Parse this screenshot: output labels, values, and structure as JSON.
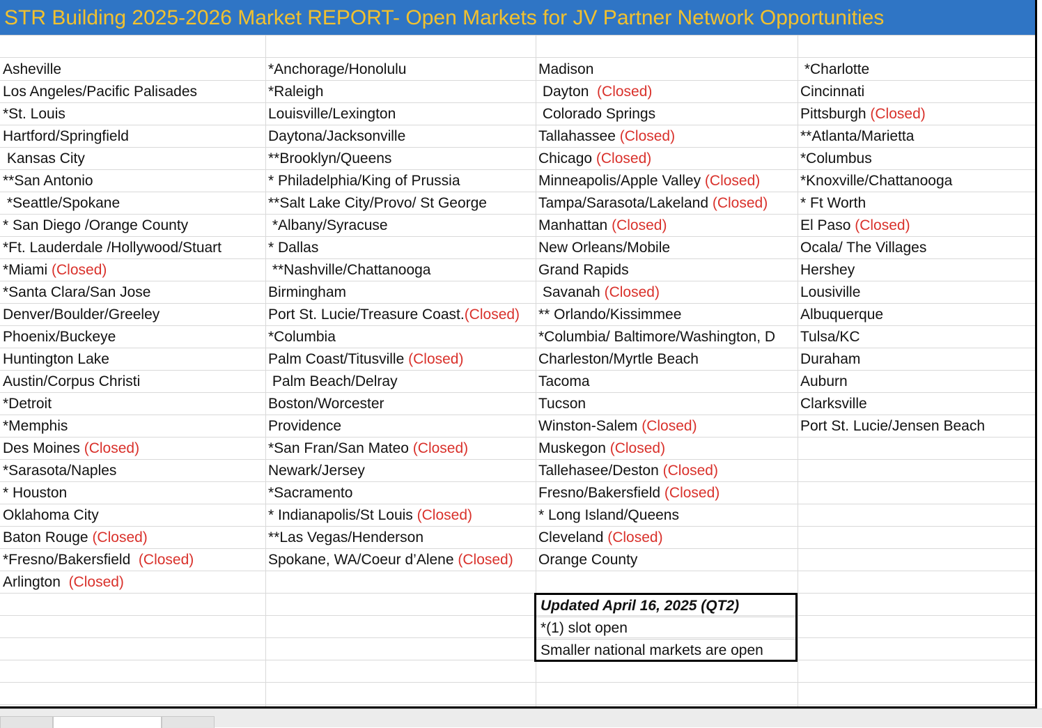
{
  "title": "STR Building 2025-2026 Market REPORT- Open Markets for JV Partner Network Opportunities",
  "colors": {
    "title_bg": "#2f75c5",
    "title_text": "#f2c12e",
    "closed": "#d9312b",
    "grid": "#d9d9d9"
  },
  "columns": [
    [
      {
        "text": "Asheville",
        "tag": ""
      },
      {
        "text": "Los Angeles/Pacific Palisades",
        "tag": ""
      },
      {
        "text": "*St. Louis",
        "tag": ""
      },
      {
        "text": "Hartford/Springfield",
        "tag": ""
      },
      {
        "text": " Kansas City",
        "tag": ""
      },
      {
        "text": "**San Antonio",
        "tag": ""
      },
      {
        "text": " *Seattle/Spokane",
        "tag": ""
      },
      {
        "text": "* San Diego /Orange County",
        "tag": ""
      },
      {
        "text": "*Ft. Lauderdale /Hollywood/Stuart",
        "tag": ""
      },
      {
        "text": "*Miami ",
        "tag": "(Closed)"
      },
      {
        "text": "*Santa Clara/San Jose",
        "tag": ""
      },
      {
        "text": "Denver/Boulder/Greeley",
        "tag": ""
      },
      {
        "text": "Phoenix/Buckeye",
        "tag": ""
      },
      {
        "text": "Huntington Lake",
        "tag": ""
      },
      {
        "text": "Austin/Corpus Christi",
        "tag": ""
      },
      {
        "text": "*Detroit",
        "tag": ""
      },
      {
        "text": "*Memphis",
        "tag": ""
      },
      {
        "text": "Des Moines ",
        "tag": "(Closed)"
      },
      {
        "text": "*Sarasota/Naples",
        "tag": ""
      },
      {
        "text": "* Houston",
        "tag": ""
      },
      {
        "text": "Oklahoma City",
        "tag": ""
      },
      {
        "text": "Baton Rouge ",
        "tag": "(Closed)"
      },
      {
        "text": "*Fresno/Bakersfield  ",
        "tag": "(Closed)"
      },
      {
        "text": "Arlington  ",
        "tag": "(Closed)"
      }
    ],
    [
      {
        "text": "*Anchorage/Honolulu",
        "tag": ""
      },
      {
        "text": "*Raleigh",
        "tag": ""
      },
      {
        "text": "Louisville/Lexington",
        "tag": ""
      },
      {
        "text": "Daytona/Jacksonville",
        "tag": ""
      },
      {
        "text": "**Brooklyn/Queens",
        "tag": ""
      },
      {
        "text": "* Philadelphia/King of Prussia",
        "tag": ""
      },
      {
        "text": "**Salt Lake City/Provo/ St George",
        "tag": ""
      },
      {
        "text": " *Albany/Syracuse",
        "tag": ""
      },
      {
        "text": "* Dallas",
        "tag": ""
      },
      {
        "text": " **Nashville/Chattanooga",
        "tag": ""
      },
      {
        "text": "Birmingham",
        "tag": ""
      },
      {
        "text": "Port St. Lucie/Treasure Coast.",
        "tag": "(Closed)"
      },
      {
        "text": "*Columbia",
        "tag": ""
      },
      {
        "text": "Palm Coast/Titusville ",
        "tag": "(Closed)"
      },
      {
        "text": " Palm Beach/Delray",
        "tag": ""
      },
      {
        "text": "Boston/Worcester",
        "tag": ""
      },
      {
        "text": "Providence",
        "tag": ""
      },
      {
        "text": "*San Fran/San Mateo ",
        "tag": "(Closed)"
      },
      {
        "text": "Newark/Jersey",
        "tag": ""
      },
      {
        "text": "*Sacramento",
        "tag": ""
      },
      {
        "text": "* Indianapolis/St Louis ",
        "tag": "(Closed)"
      },
      {
        "text": "**Las Vegas/Henderson",
        "tag": ""
      },
      {
        "text": "Spokane, WA/Coeur d’Alene ",
        "tag": "(Closed)"
      }
    ],
    [
      {
        "text": "Madison",
        "tag": ""
      },
      {
        "text": " Dayton  ",
        "tag": "(Closed)"
      },
      {
        "text": " Colorado Springs",
        "tag": ""
      },
      {
        "text": "Tallahassee ",
        "tag": "(Closed)"
      },
      {
        "text": "Chicago ",
        "tag": "(Closed)"
      },
      {
        "text": "Minneapolis/Apple Valley ",
        "tag": "(Closed)"
      },
      {
        "text": "Tampa/Sarasota/Lakeland ",
        "tag": "(Closed)"
      },
      {
        "text": "Manhattan ",
        "tag": "(Closed)"
      },
      {
        "text": "New Orleans/Mobile",
        "tag": ""
      },
      {
        "text": "Grand Rapids",
        "tag": ""
      },
      {
        "text": " Savanah ",
        "tag": "(Closed)"
      },
      {
        "text": "** Orlando/Kissimmee",
        "tag": ""
      },
      {
        "text": "*Columbia/ Baltimore/Washington, D",
        "tag": ""
      },
      {
        "text": "Charleston/Myrtle Beach",
        "tag": ""
      },
      {
        "text": "Tacoma",
        "tag": ""
      },
      {
        "text": "Tucson",
        "tag": ""
      },
      {
        "text": "Winston-Salem ",
        "tag": "(Closed)"
      },
      {
        "text": "Muskegon ",
        "tag": "(Closed)"
      },
      {
        "text": "Tallehasee/Deston ",
        "tag": "(Closed)"
      },
      {
        "text": "Fresno/Bakersfield ",
        "tag": "(Closed)"
      },
      {
        "text": "* Long Island/Queens",
        "tag": ""
      },
      {
        "text": "Cleveland ",
        "tag": "(Closed)"
      },
      {
        "text": "Orange County",
        "tag": ""
      }
    ],
    [
      {
        "text": " *Charlotte",
        "tag": ""
      },
      {
        "text": "Cincinnati",
        "tag": ""
      },
      {
        "text": "Pittsburgh ",
        "tag": "(Closed)"
      },
      {
        "text": "**Atlanta/Marietta",
        "tag": ""
      },
      {
        "text": "*Columbus",
        "tag": ""
      },
      {
        "text": "*Knoxville/Chattanooga",
        "tag": ""
      },
      {
        "text": "* Ft Worth",
        "tag": ""
      },
      {
        "text": "El Paso ",
        "tag": "(Closed)"
      },
      {
        "text": "Ocala/ The Villages",
        "tag": ""
      },
      {
        "text": "Hershey",
        "tag": ""
      },
      {
        "text": "Lousiville",
        "tag": ""
      },
      {
        "text": "Albuquerque",
        "tag": ""
      },
      {
        "text": "Tulsa/KC",
        "tag": ""
      },
      {
        "text": "Duraham",
        "tag": ""
      },
      {
        "text": "Auburn",
        "tag": ""
      },
      {
        "text": "Clarksville",
        "tag": ""
      },
      {
        "text": "Port St. Lucie/Jensen Beach",
        "tag": ""
      }
    ]
  ],
  "notes": {
    "updated": "Updated April 16, 2025 (QT2)",
    "slot": "*(1) slot open",
    "smaller": "Smaller national markets are open"
  }
}
